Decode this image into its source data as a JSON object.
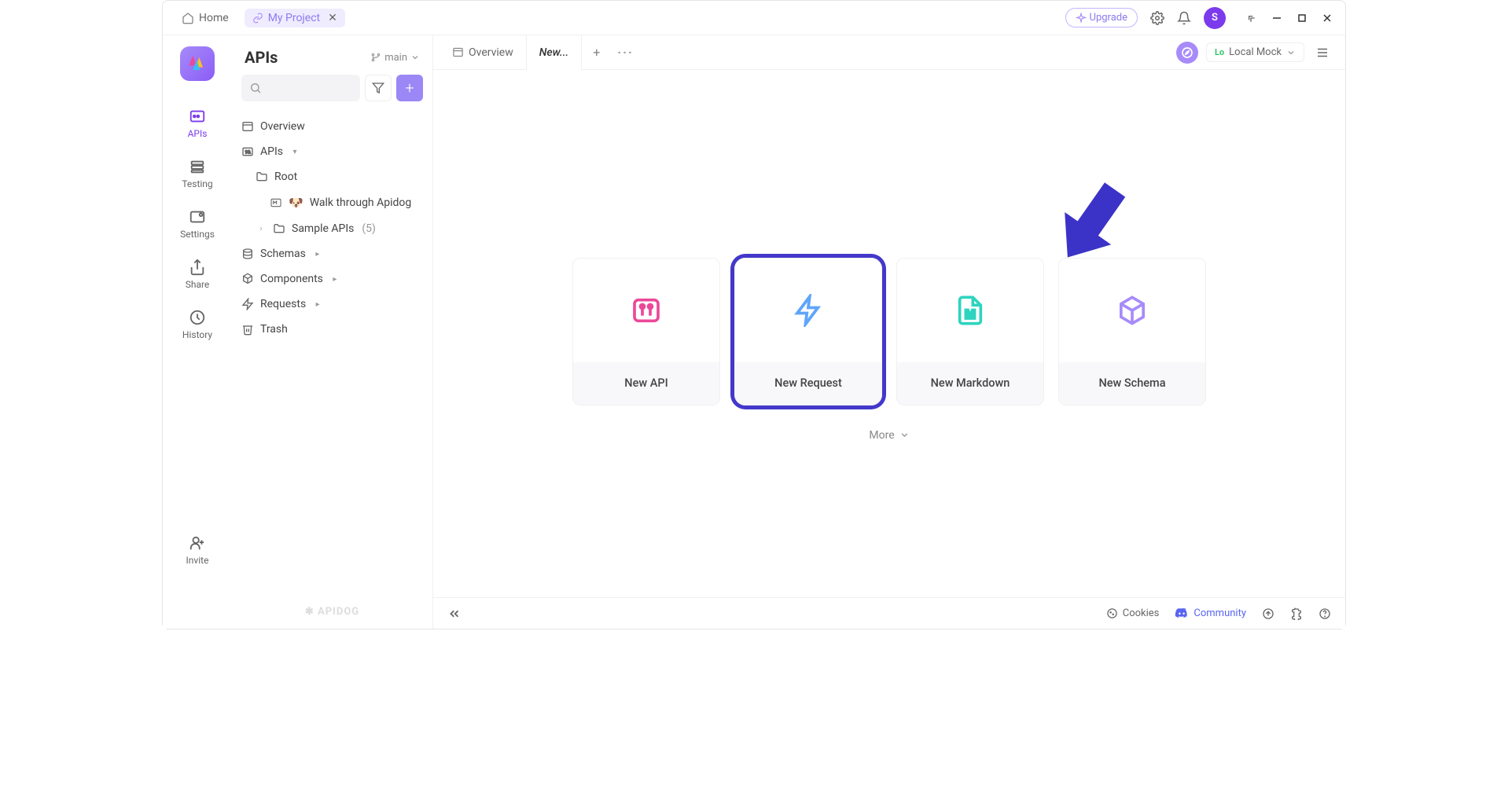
{
  "titlebar": {
    "home": "Home",
    "tab": "My Project",
    "upgrade": "Upgrade",
    "avatar_letter": "S"
  },
  "rail": {
    "items": [
      {
        "label": "APIs"
      },
      {
        "label": "Testing"
      },
      {
        "label": "Settings"
      },
      {
        "label": "Share"
      },
      {
        "label": "History"
      }
    ],
    "invite": "Invite"
  },
  "sidebar": {
    "title": "APIs",
    "branch": "main",
    "overview": "Overview",
    "apis": "APIs",
    "root": "Root",
    "walkthrough": "Walk through Apidog",
    "sample": "Sample APIs",
    "sample_count": "(5)",
    "schemas": "Schemas",
    "components": "Components",
    "requests": "Requests",
    "trash": "Trash",
    "brand": "APIDOG"
  },
  "tabs": {
    "overview": "Overview",
    "new": "New...",
    "env_prefix": "Lo",
    "env": "Local Mock"
  },
  "cards": {
    "items": [
      {
        "label": "New API"
      },
      {
        "label": "New Request"
      },
      {
        "label": "New Markdown"
      },
      {
        "label": "New Schema"
      }
    ],
    "more": "More"
  },
  "footer": {
    "cookies": "Cookies",
    "community": "Community"
  }
}
